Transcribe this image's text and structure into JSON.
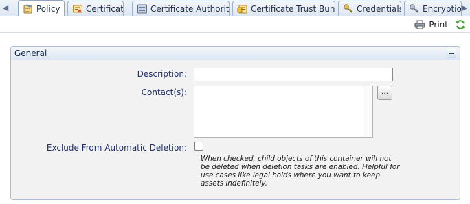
{
  "tabs": [
    {
      "label": "Policy",
      "icon": "policy-icon",
      "active": true
    },
    {
      "label": "Certificate",
      "icon": "certificate-icon",
      "active": false
    },
    {
      "label": "Certificate Authorities",
      "icon": "certificate-authorities-icon",
      "active": false
    },
    {
      "label": "Certificate Trust Bundle",
      "icon": "trust-bundle-icon",
      "active": false
    },
    {
      "label": "Credentials",
      "icon": "credentials-icon",
      "active": false
    },
    {
      "label": "Encryption",
      "icon": "encryption-icon",
      "active": false
    }
  ],
  "toolbar": {
    "print_label": "Print"
  },
  "panel": {
    "title": "General",
    "fields": {
      "description_label": "Description:",
      "description_value": "",
      "contacts_label": "Contact(s):",
      "contacts_button": "...",
      "exclude_label": "Exclude From Automatic Deletion:",
      "exclude_checked": false,
      "exclude_help": "When checked, child objects of this container will not be deleted when deletion tasks are enabled. Helpful for use cases like legal holds where you want to keep assets indefinitely."
    }
  }
}
